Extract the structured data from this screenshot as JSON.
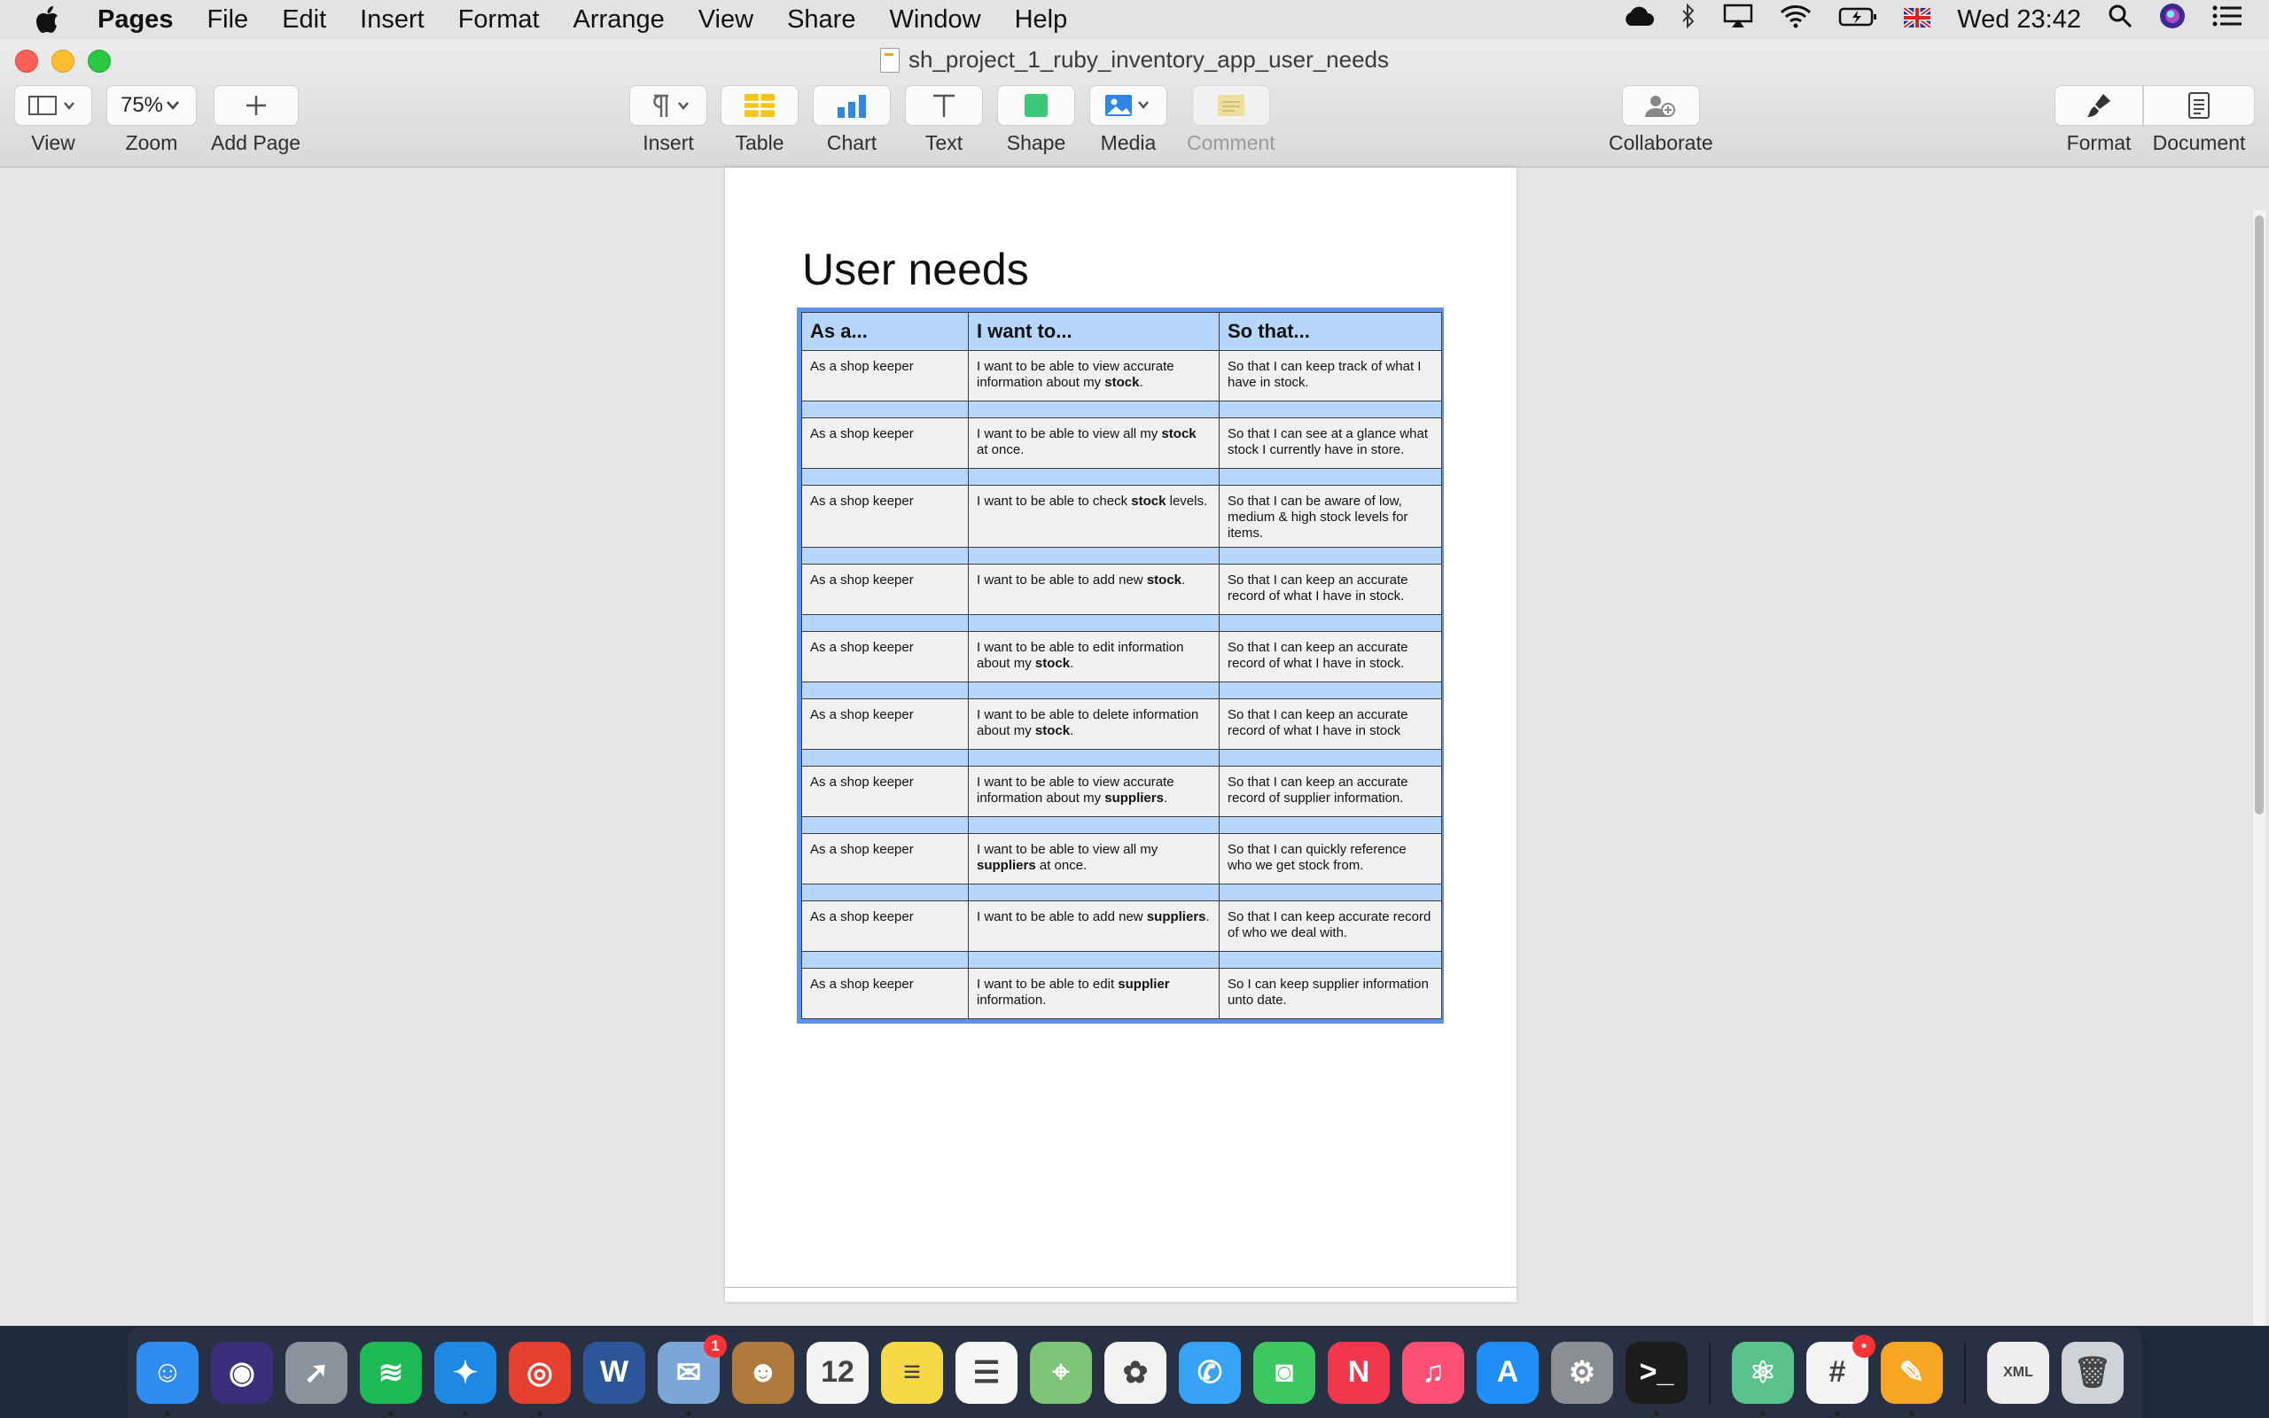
{
  "menubar": {
    "app_name": "Pages",
    "items": [
      "File",
      "Edit",
      "Insert",
      "Format",
      "Arrange",
      "View",
      "Share",
      "Window",
      "Help"
    ],
    "clock": "Wed 23:42"
  },
  "window": {
    "title": "sh_project_1_ruby_inventory_app_user_needs"
  },
  "toolbar": {
    "view_label": "View",
    "zoom_value": "75%",
    "zoom_label": "Zoom",
    "add_page_label": "Add Page",
    "insert_label": "Insert",
    "table_label": "Table",
    "chart_label": "Chart",
    "text_label": "Text",
    "shape_label": "Shape",
    "media_label": "Media",
    "comment_label": "Comment",
    "collaborate_label": "Collaborate",
    "format_label": "Format",
    "document_label": "Document"
  },
  "document": {
    "heading": "User needs",
    "table": {
      "headers": [
        "As a...",
        "I want to...",
        "So that..."
      ],
      "rows": [
        {
          "as": "As a shop keeper",
          "want_pre": "I want to be able to view accurate information about my ",
          "want_bold": "stock",
          "want_post": ".",
          "so": "So that I can keep track of what I have in stock."
        },
        {
          "as": "As a shop keeper",
          "want_pre": "I want to be able to view all my ",
          "want_bold": "stock",
          "want_post": " at once.",
          "so": "So that I can see at a glance what stock I currently have in store."
        },
        {
          "as": "As a shop keeper",
          "want_pre": "I want to be able to check ",
          "want_bold": "stock",
          "want_post": " levels.",
          "so": "So that I can be aware of low, medium & high stock levels for items."
        },
        {
          "as": "As a shop keeper",
          "want_pre": "I want to be able to add new ",
          "want_bold": "stock",
          "want_post": ".",
          "so": "So that I can keep an accurate record of what I have in stock."
        },
        {
          "as": "As a shop keeper",
          "want_pre": "I want to be able to edit information about my ",
          "want_bold": "stock",
          "want_post": ".",
          "so": "So that I can keep an accurate record of what I have in stock."
        },
        {
          "as": "As a shop keeper",
          "want_pre": "I want to be able to delete information about my ",
          "want_bold": "stock",
          "want_post": ".",
          "so": "So that I can keep an accurate record of what I have in stock"
        },
        {
          "as": "As a shop keeper",
          "want_pre": "I want to be able to view accurate information about my ",
          "want_bold": "suppliers",
          "want_post": ".",
          "so": "So that I can keep an accurate record of supplier information."
        },
        {
          "as": "As a shop keeper",
          "want_pre": "I  want to be able to view all my ",
          "want_bold": "suppliers",
          "want_post": " at once.",
          "so": "So that I can quickly reference who we get stock from."
        },
        {
          "as": "As a shop keeper",
          "want_pre": "I want to be able to add new ",
          "want_bold": "suppliers",
          "want_post": ".",
          "so": "So that I can keep accurate record of who we deal with."
        },
        {
          "as": "As a shop keeper",
          "want_pre": "I want to be able to edit ",
          "want_bold": "supplier",
          "want_post": " information.",
          "so": "So I can keep supplier information unto date."
        }
      ]
    }
  },
  "dock": {
    "apps": [
      {
        "name": "finder-icon",
        "glyph": "☺",
        "color": "#2f8cf0",
        "running": true
      },
      {
        "name": "siri-icon",
        "glyph": "◉",
        "color": "#3a2f7a",
        "running": false
      },
      {
        "name": "launchpad-icon",
        "glyph": "➚",
        "color": "#8a929c",
        "running": false
      },
      {
        "name": "spotify-icon",
        "glyph": "≋",
        "color": "#1db954",
        "running": true
      },
      {
        "name": "safari-icon",
        "glyph": "✦",
        "color": "#1e88e5",
        "running": true
      },
      {
        "name": "chrome-icon",
        "glyph": "◎",
        "color": "#e5402f",
        "running": true
      },
      {
        "name": "word-icon",
        "glyph": "W",
        "color": "#2b579a",
        "running": false
      },
      {
        "name": "mail-icon",
        "glyph": "✉",
        "color": "#7ca5d8",
        "running": true,
        "badge": "1"
      },
      {
        "name": "contacts-icon",
        "glyph": "☻",
        "color": "#b07a3e",
        "running": false
      },
      {
        "name": "calendar-icon",
        "glyph": "12",
        "color": "#f4f4f4",
        "running": false
      },
      {
        "name": "notes-icon",
        "glyph": "≡",
        "color": "#f7d948",
        "running": false
      },
      {
        "name": "reminders-icon",
        "glyph": "☰",
        "color": "#f6f6f6",
        "running": false
      },
      {
        "name": "maps-icon",
        "glyph": "⌖",
        "color": "#7cc576",
        "running": false
      },
      {
        "name": "photos-icon",
        "glyph": "✿",
        "color": "#f2f2f2",
        "running": false
      },
      {
        "name": "messages-icon",
        "glyph": "✆",
        "color": "#36a3f7",
        "running": false
      },
      {
        "name": "facetime-icon",
        "glyph": "◙",
        "color": "#3cc760",
        "running": false
      },
      {
        "name": "news-icon",
        "glyph": "N",
        "color": "#f2364d",
        "running": false
      },
      {
        "name": "music-icon",
        "glyph": "♫",
        "color": "#fb4f74",
        "running": false
      },
      {
        "name": "app-store-icon",
        "glyph": "A",
        "color": "#1f8df5",
        "running": false
      },
      {
        "name": "system-preferences-icon",
        "glyph": "⚙",
        "color": "#8b8f94",
        "running": false
      },
      {
        "name": "terminal-icon",
        "glyph": ">_",
        "color": "#1c1c1c",
        "running": true
      },
      {
        "name": "atom-icon",
        "glyph": "⚛",
        "color": "#5ac38b",
        "running": true
      },
      {
        "name": "slack-icon",
        "glyph": "#",
        "color": "#f4f4f4",
        "running": true,
        "badge": "•"
      },
      {
        "name": "pages-icon",
        "glyph": "✎",
        "color": "#f6a623",
        "running": true
      }
    ],
    "trailing": [
      {
        "name": "xml-file-icon",
        "glyph": "XML",
        "color": "#eeeeee"
      },
      {
        "name": "trash-icon",
        "glyph": "🗑",
        "color": "#cfd2d6"
      }
    ]
  }
}
